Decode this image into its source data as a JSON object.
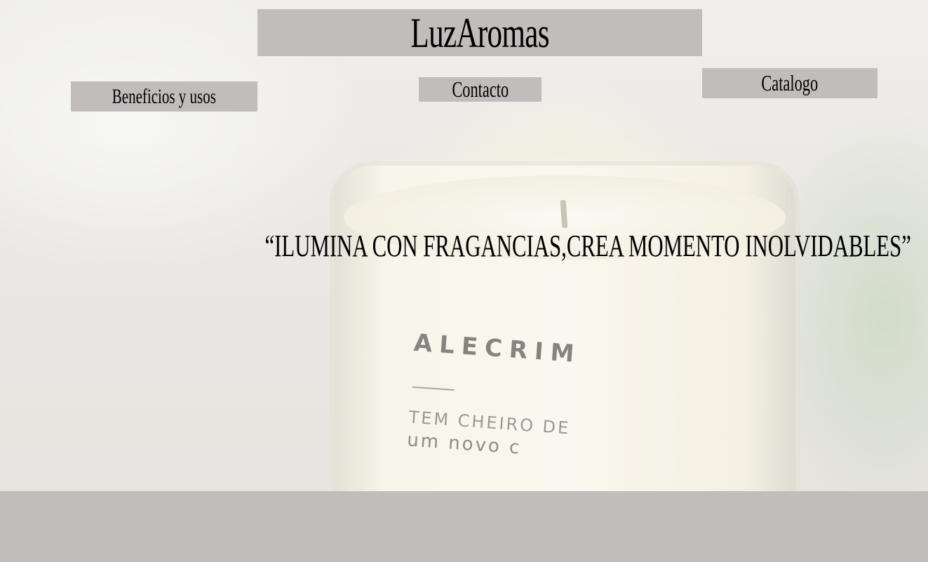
{
  "header": {
    "logo": "LuzAromas"
  },
  "nav": {
    "benefits_label": "Beneficios y usos",
    "contact_label": "Contacto",
    "catalog_label": "Catalogo"
  },
  "hero": {
    "tagline": "“ILUMINA CON FRAGANCIAS,CREA MOMENTO INOLVIDABLES”",
    "jar_label": {
      "brand": "ALECRIM",
      "line1": "TEM CHEIRO DE",
      "line2": "um novo c"
    }
  },
  "colors": {
    "accent_box": "#c1bdbd",
    "text": "#000000"
  }
}
